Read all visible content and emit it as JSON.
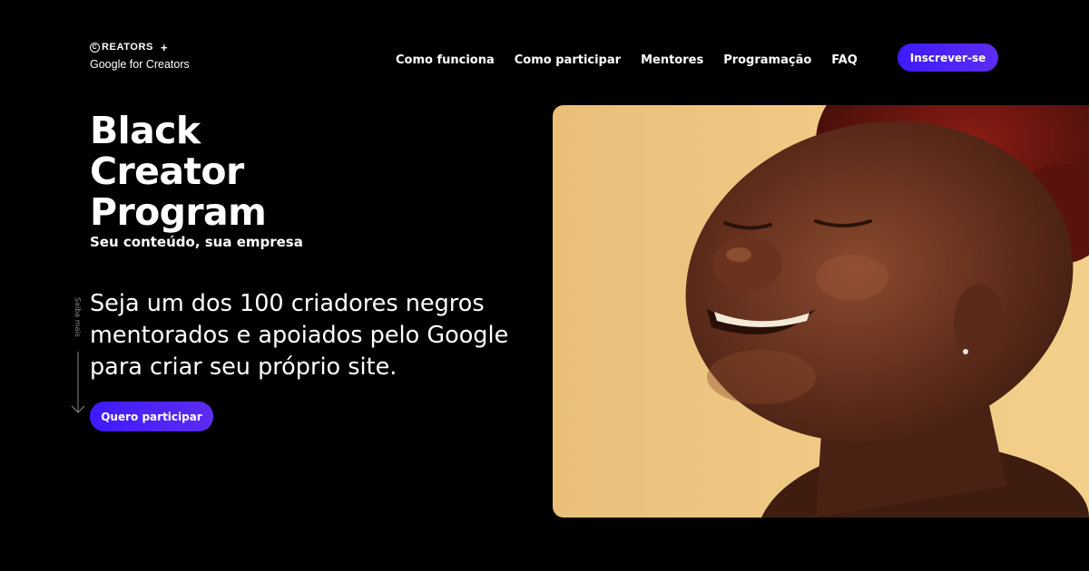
{
  "logo": {
    "top_text": "REATORS",
    "top_c": "C",
    "plus": "+",
    "bottom_text": "Google for Creators"
  },
  "nav": {
    "items": [
      {
        "label": "Como funciona"
      },
      {
        "label": "Como participar"
      },
      {
        "label": "Mentores"
      },
      {
        "label": "Programação"
      },
      {
        "label": "FAQ"
      }
    ]
  },
  "header": {
    "signup_label": "Inscrever-se"
  },
  "hero": {
    "title": "Black\nCreator\nProgram",
    "subtitle": "Seu conteúdo, sua empresa",
    "description": "Seja um dos 100 criadores negros mentorados e apoiados pelo Google para criar seu próprio site.",
    "cta_label": "Quero participar",
    "scroll_label": "Saiba mais",
    "image_icon": "smiling-woman-photo"
  },
  "colors": {
    "background": "#000000",
    "accent": "#3d1aff",
    "accent_end": "#5e2cf0",
    "photo_background": "#f0c77e"
  }
}
